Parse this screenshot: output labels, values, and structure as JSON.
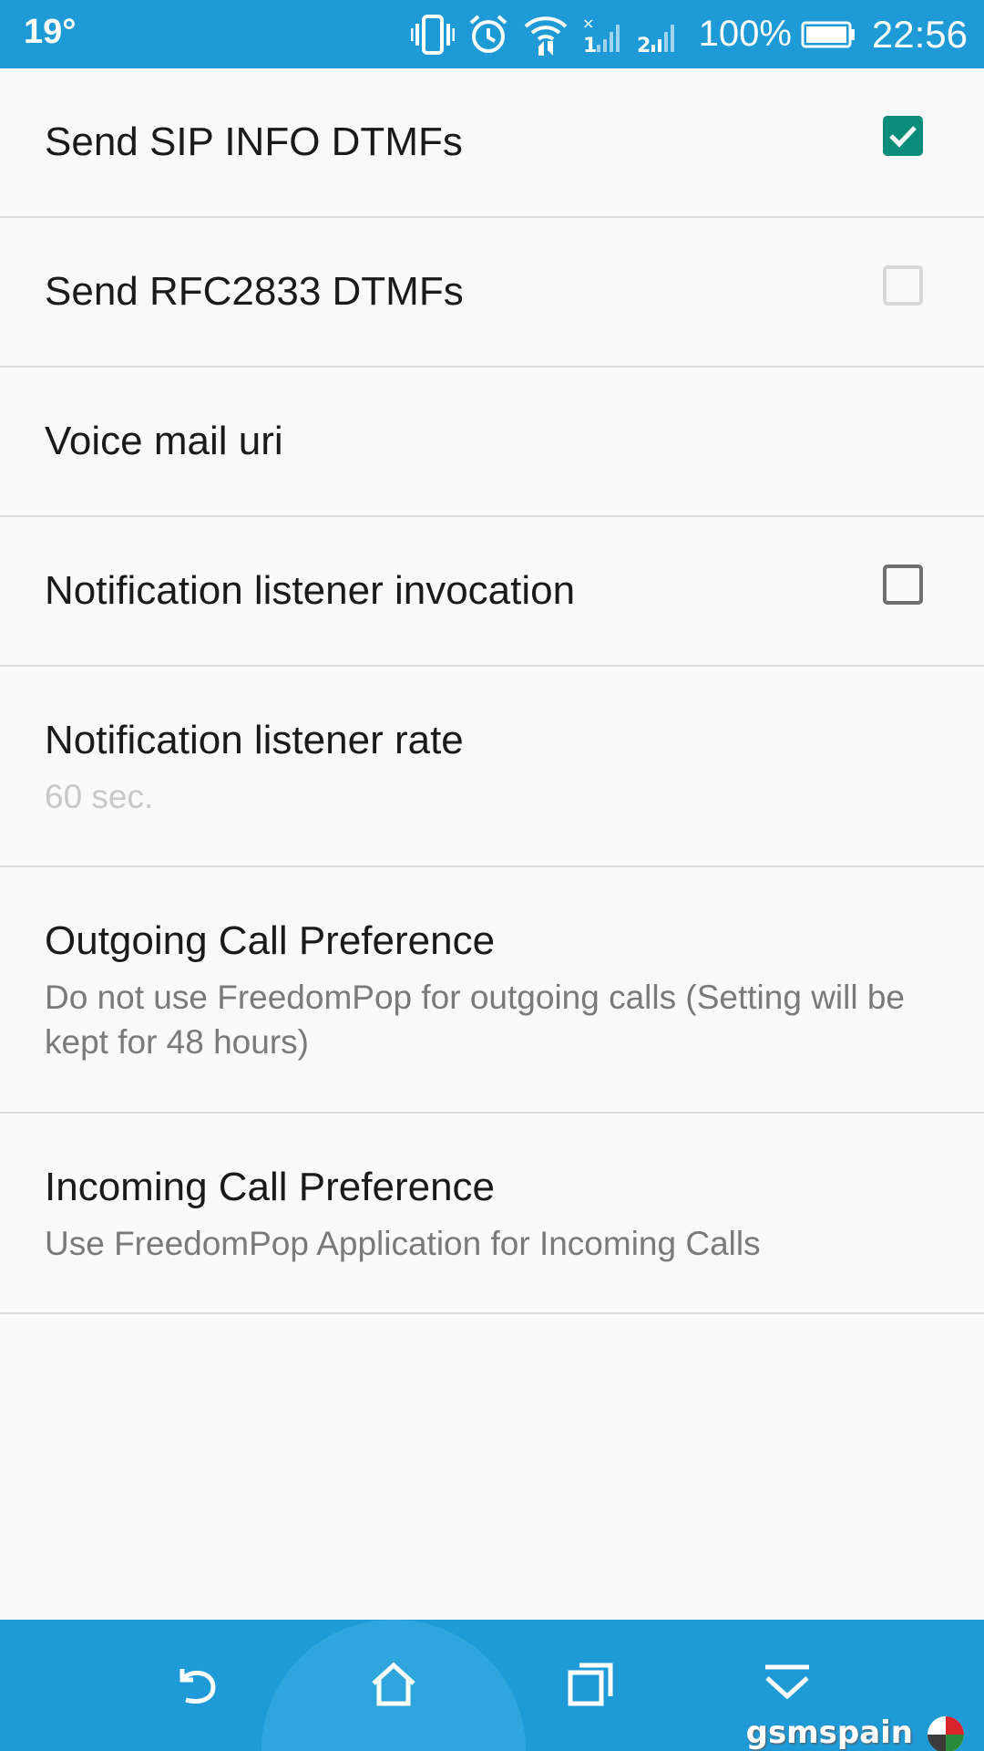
{
  "status_bar": {
    "temperature": "19°",
    "battery_percent": "100%",
    "time": "22:56",
    "icons": [
      "vibrate-icon",
      "alarm-icon",
      "wifi-icon",
      "signal-sim1-icon",
      "signal-sim2-icon",
      "battery-icon"
    ]
  },
  "preferences": {
    "sip_info": {
      "title": "Send SIP INFO DTMFs",
      "checked": true
    },
    "rfc2833": {
      "title": "Send RFC2833 DTMFs",
      "checked": false
    },
    "voicemail": {
      "title": "Voice mail uri"
    },
    "notif_invocation": {
      "title": "Notification listener invocation",
      "checked": false
    },
    "notif_rate": {
      "title": "Notification listener rate",
      "summary": "60 sec."
    },
    "outgoing": {
      "title": "Outgoing Call Preference",
      "summary": "Do not use FreedomPop for outgoing calls (Setting will be kept for 48 hours)"
    },
    "incoming": {
      "title": "Incoming Call Preference",
      "summary": "Use FreedomPop Application for Incoming Calls"
    }
  },
  "nav_bar": {
    "buttons": [
      "back-icon",
      "home-icon",
      "recents-icon",
      "hide-nav-icon"
    ]
  },
  "watermark": {
    "text": "gsmspain"
  },
  "colors": {
    "accent": "#1e9bd7",
    "checkbox_checked": "#0a8c7a",
    "divider": "#dcdcdc",
    "summary_text": "#7a7a7a"
  }
}
